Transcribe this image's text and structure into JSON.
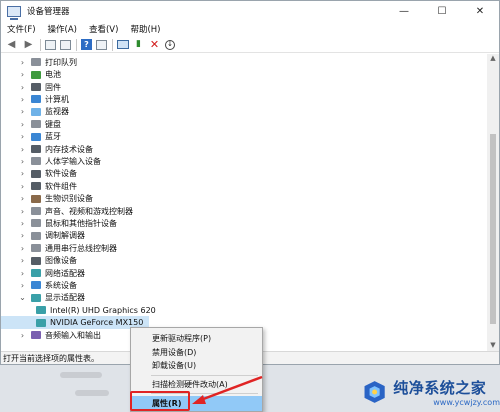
{
  "window": {
    "title": "设备管理器",
    "controls": {
      "minimize": "—",
      "maximize": "☐",
      "close": "✕"
    }
  },
  "menu": [
    "文件(F)",
    "操作(A)",
    "查看(V)",
    "帮助(H)"
  ],
  "toolbar": {
    "icons": [
      "back-arrow-icon",
      "forward-arrow-icon",
      "properties-icon",
      "view-icon",
      "help-icon",
      "show-hidden-icon",
      "scan-monitor-icon",
      "enable-device-icon",
      "uninstall-x-icon",
      "update-driver-icon"
    ]
  },
  "tree": {
    "categories": [
      {
        "label": "打印队列",
        "icon": "printer-icon"
      },
      {
        "label": "电池",
        "icon": "battery-icon"
      },
      {
        "label": "固件",
        "icon": "firmware-icon"
      },
      {
        "label": "计算机",
        "icon": "computer-icon"
      },
      {
        "label": "监视器",
        "icon": "monitor-icon"
      },
      {
        "label": "键盘",
        "icon": "keyboard-icon"
      },
      {
        "label": "蓝牙",
        "icon": "bluetooth-icon"
      },
      {
        "label": "内存技术设备",
        "icon": "memory-icon"
      },
      {
        "label": "人体学输入设备",
        "icon": "hid-icon"
      },
      {
        "label": "软件设备",
        "icon": "software-device-icon"
      },
      {
        "label": "软件组件",
        "icon": "software-component-icon"
      },
      {
        "label": "生物识别设备",
        "icon": "biometric-icon"
      },
      {
        "label": "声音、视频和游戏控制器",
        "icon": "sound-icon"
      },
      {
        "label": "鼠标和其他指针设备",
        "icon": "mouse-icon"
      },
      {
        "label": "调制解调器",
        "icon": "modem-icon"
      },
      {
        "label": "通用串行总线控制器",
        "icon": "usb-icon"
      },
      {
        "label": "图像设备",
        "icon": "camera-icon"
      },
      {
        "label": "网络适配器",
        "icon": "network-icon"
      },
      {
        "label": "系统设备",
        "icon": "system-icon"
      },
      {
        "label": "显示适配器",
        "icon": "display-adapter-icon",
        "expanded": true
      }
    ],
    "display_children": [
      "Intel(R) UHD Graphics 620",
      "NVIDIA GeForce MX150"
    ],
    "after": [
      {
        "label": "音频输入和输出",
        "icon": "audio-icon"
      }
    ]
  },
  "status_text": "打开当前选择项的属性表。",
  "context_menu": {
    "items": [
      "更新驱动程序(P)",
      "禁用设备(D)",
      "卸载设备(U)",
      "扫描检测硬件改动(A)",
      "属性(R)"
    ],
    "highlighted": "属性(R)"
  },
  "watermark": {
    "title": "纯净系统之家",
    "url": "www.ycwjzy.com"
  },
  "colors": {
    "highlight": "#91c9f7",
    "annotation_red": "#e02424",
    "brand_blue": "#1d4f9a"
  }
}
